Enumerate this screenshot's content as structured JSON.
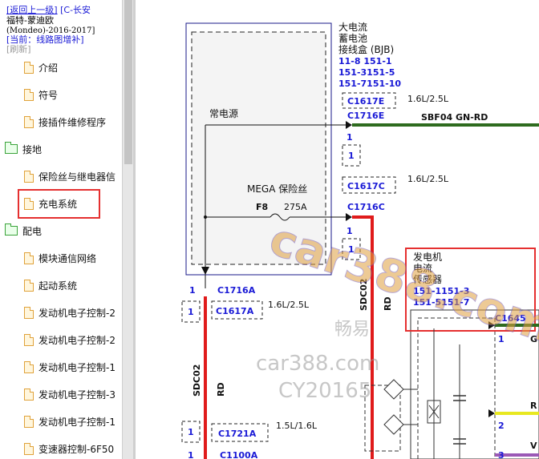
{
  "sidebar": {
    "back_link": "[返回上一级]",
    "vehicle_line1": "[C-长安",
    "vehicle_line2": "福特-蒙迪欧",
    "vehicle_line3": "(Mondeo)-2016-2017]",
    "current_path": "[当前：线路图增补]",
    "refresh": "[刷新]",
    "items": [
      {
        "label": "介绍",
        "type": "file"
      },
      {
        "label": "符号",
        "type": "file"
      },
      {
        "label": "接插件维修程序",
        "type": "file"
      },
      {
        "label": "接地",
        "type": "folder"
      },
      {
        "label": "保险丝与继电器信",
        "type": "file"
      },
      {
        "label": "充电系统",
        "type": "file",
        "highlighted": true
      },
      {
        "label": "配电",
        "type": "folder"
      },
      {
        "label": "模块通信网络",
        "type": "file"
      },
      {
        "label": "起动系统",
        "type": "file"
      },
      {
        "label": "发动机电子控制-2",
        "type": "file"
      },
      {
        "label": "发动机电子控制-2",
        "type": "file"
      },
      {
        "label": "发动机电子控制-1",
        "type": "file"
      },
      {
        "label": "发动机电子控制-3",
        "type": "file"
      },
      {
        "label": "发动机电子控制-1",
        "type": "file"
      },
      {
        "label": "变速器控制-6F50",
        "type": "file"
      }
    ]
  },
  "diagram": {
    "bjb_title1": "大电流",
    "bjb_title2": "蓄电池",
    "bjb_title3": "接线盒 (BJB)",
    "bjb_ref1": "11-8  151-1",
    "bjb_ref2": "151-3151-5",
    "bjb_ref3": "151-7151-10",
    "conn_c1617e": "C1617E",
    "conn_c1716e": "C1716E",
    "wire_1": "1.6L/2.5L",
    "circuit_sbf04": "SBF04  GN-RD",
    "pin_1": "1",
    "always_power": "常电源",
    "conn_c1617c": "C1617C",
    "mega_fuse": "MEGA 保险丝",
    "fuse_id": "F8",
    "fuse_rating": "275A",
    "conn_c1716c": "C1716C",
    "conn_c1716a": "C1716A",
    "conn_c1617a": "C1617A",
    "circuit_sdc02": "SDC02",
    "wire_rd": "RD",
    "conn_c1721a": "C1721A",
    "wire_15": "1.5L/1.6L",
    "conn_c1100a": "C1100A",
    "sensor_title1": "发电机",
    "sensor_title2": "电流",
    "sensor_title3": "传感器",
    "sensor_ref1": "151-1151-3",
    "sensor_ref2": "151-5151-7",
    "conn_c1645": "C1645",
    "wire_g": "G",
    "wire_r": "R",
    "wire_v": "V",
    "pin_2": "2",
    "pin_3": "3",
    "watermark1": "car388.com",
    "watermark2": "畅易",
    "watermark3": "car388.com",
    "watermark4": "CY20165"
  }
}
